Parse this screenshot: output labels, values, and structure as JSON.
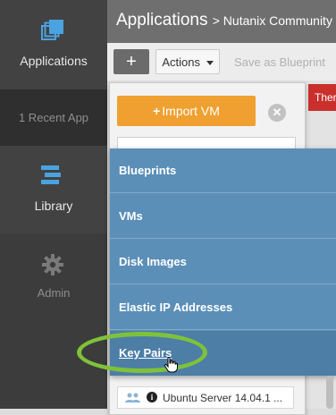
{
  "sidebar": {
    "applications_label": "Applications",
    "recent_label": "1 Recent App",
    "library_label": "Library",
    "admin_label": "Admin"
  },
  "header": {
    "title": "Applications",
    "breadcrumb": "> Nutanix Community ..."
  },
  "toolbar": {
    "add_label": "+",
    "actions_label": "Actions",
    "save_label": "Save as Blueprint"
  },
  "alert": {
    "text": "Ther"
  },
  "panel": {
    "import_label": "Import VM",
    "close_label": "✕"
  },
  "menu": {
    "items": [
      {
        "label": "Blueprints"
      },
      {
        "label": "VMs"
      },
      {
        "label": "Disk Images"
      },
      {
        "label": "Elastic IP Addresses"
      },
      {
        "label": "Key Pairs"
      }
    ],
    "selected": "Key Pairs"
  },
  "blueprint_row": {
    "name": "Ubuntu Server 14.04.1 ..."
  },
  "colors": {
    "sidebar_bg": "#3c3c3c",
    "accent_orange": "#f0a030",
    "menu_blue": "#5b8fb8",
    "highlight_green": "#7fc23a",
    "alert_red": "#c9302c",
    "icon_blue": "#4aa3e0"
  },
  "icons": [
    "applications-icon",
    "library-icon",
    "gear-icon",
    "plus-icon",
    "caret-down-icon",
    "close-icon",
    "users-icon",
    "info-icon",
    "hand-cursor-icon"
  ]
}
